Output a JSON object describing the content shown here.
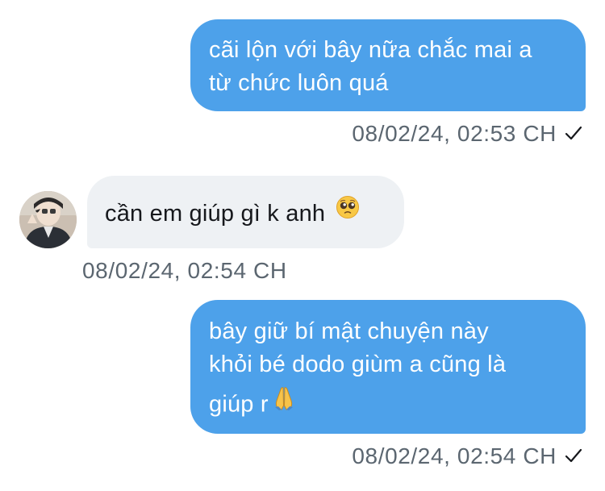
{
  "conversation": {
    "messages": [
      {
        "direction": "outgoing",
        "lines": [
          "cãi lộn với bây nữa chắc mai a",
          "từ chức luôn quá"
        ],
        "timestamp": "08/02/24, 02:53 CH",
        "status_icon": "check-icon"
      },
      {
        "direction": "incoming",
        "text": "cần em giúp gì k anh",
        "emoji": "pleading-face-emoji",
        "timestamp": "08/02/24, 02:54 CH",
        "avatar": "user-avatar"
      },
      {
        "direction": "outgoing",
        "lines": [
          "bây giữ bí mật chuyện này",
          "khỏi bé dodo giùm a cũng là",
          "giúp r"
        ],
        "emoji": "folded-hands-emoji",
        "timestamp": "08/02/24, 02:54 CH",
        "status_icon": "check-icon"
      }
    ]
  },
  "colors": {
    "outgoing_bubble": "#4da1ea",
    "incoming_bubble": "#eef1f4",
    "timestamp_text": "#5b6670"
  }
}
